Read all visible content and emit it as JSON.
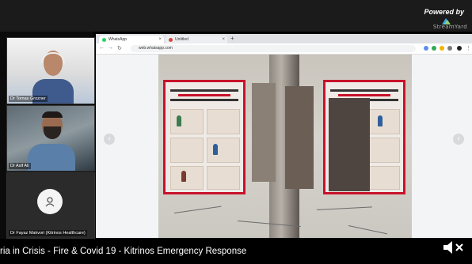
{
  "overlay": {
    "powered_label": "Powered by",
    "brand_label": "StreamYard"
  },
  "participants": [
    {
      "name": "Dr Tomas Grozner"
    },
    {
      "name": "Dr Asif Ali"
    },
    {
      "name": "Dr Fayaz Makvori (Kitrinos Healthcare)"
    }
  ],
  "browser": {
    "tabs": [
      {
        "label": "WhatsApp",
        "icon": "whatsapp-icon",
        "color": "#25d366"
      },
      {
        "label": "Untitled",
        "icon": "page-icon",
        "color": "#d9453a"
      }
    ],
    "url": "web.whatsapp.com",
    "nav_icons": [
      "back-icon",
      "forward-icon",
      "reload-icon"
    ]
  },
  "caption": {
    "text": "ria in Crisis - Fire & Covid 19 - Kitrinos Emergency Response"
  },
  "colors": {
    "poster_red": "#c8122b",
    "background": "#000000"
  }
}
